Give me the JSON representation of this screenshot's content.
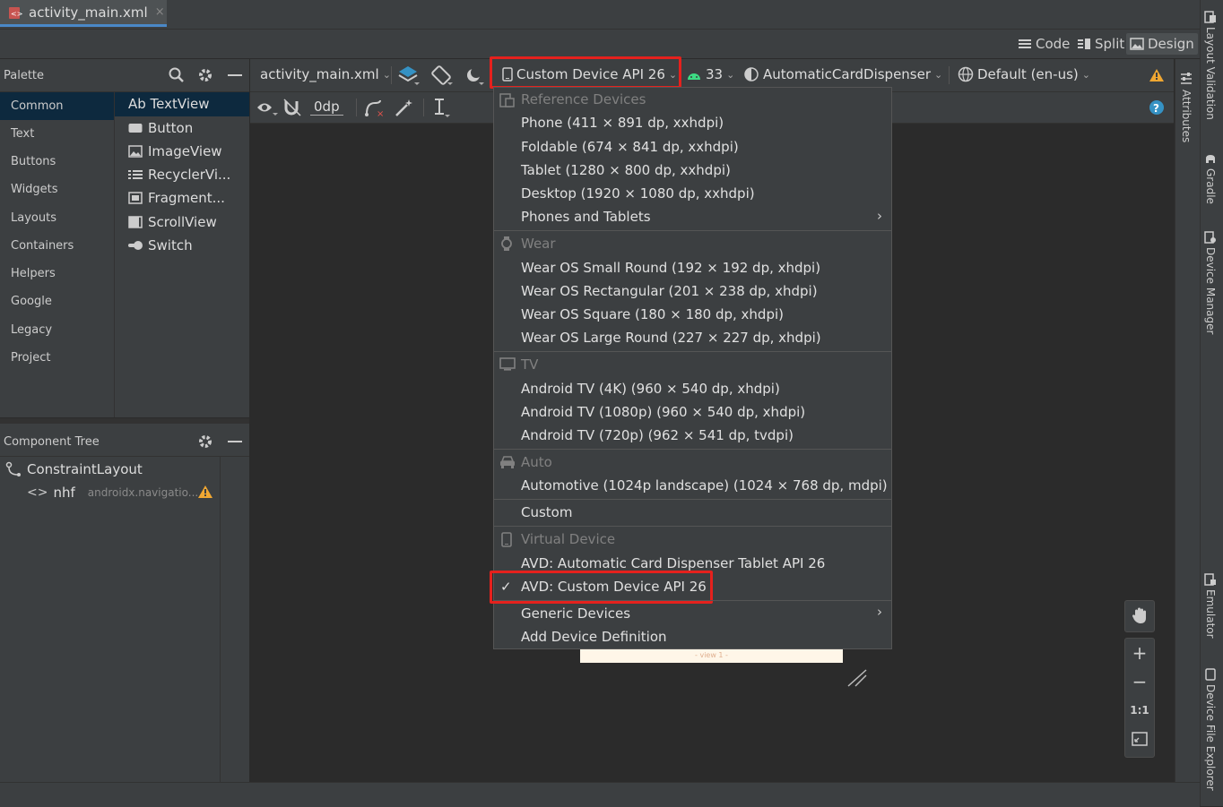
{
  "tab": {
    "filename": "activity_main.xml",
    "close": "×"
  },
  "modes": {
    "code": "Code",
    "split": "Split",
    "design": "Design"
  },
  "palette": {
    "title": "Palette",
    "categories": [
      "Common",
      "Text",
      "Buttons",
      "Widgets",
      "Layouts",
      "Containers",
      "Helpers",
      "Google",
      "Legacy",
      "Project"
    ],
    "widgets": [
      {
        "icon": "text-view-icon",
        "label": "Ab TextView"
      },
      {
        "icon": "button-icon",
        "label": "Button"
      },
      {
        "icon": "image-view-icon",
        "label": "ImageView"
      },
      {
        "icon": "recycler-view-icon",
        "label": "RecyclerVi..."
      },
      {
        "icon": "fragment-icon",
        "label": "Fragment..."
      },
      {
        "icon": "scroll-view-icon",
        "label": "ScrollView"
      },
      {
        "icon": "switch-icon",
        "label": "Switch"
      }
    ]
  },
  "component_tree": {
    "title": "Component Tree",
    "root": "ConstraintLayout",
    "child_id": "nhf",
    "child_class": "androidx.navigatio..."
  },
  "toolbar": {
    "file": "activity_main.xml",
    "device": "Custom Device API 26",
    "api": "33",
    "theme": "AutomaticCardDispenser",
    "locale": "Default (en-us)",
    "margin": "0dp"
  },
  "menu": {
    "reference_header": "Reference Devices",
    "reference": [
      "Phone (411 × 891 dp, xxhdpi)",
      "Foldable (674 × 841 dp, xxhdpi)",
      "Tablet (1280 × 800 dp, xxhdpi)",
      "Desktop (1920 × 1080 dp, xxhdpi)",
      "Phones and Tablets"
    ],
    "wear_header": "Wear",
    "wear": [
      "Wear OS Small Round (192 × 192 dp, xhdpi)",
      "Wear OS Rectangular (201 × 238 dp, xhdpi)",
      "Wear OS Square (180 × 180 dp, xhdpi)",
      "Wear OS Large Round (227 × 227 dp, xhdpi)"
    ],
    "tv_header": "TV",
    "tv": [
      "Android TV (4K) (960 × 540 dp, xhdpi)",
      "Android TV (1080p) (960 × 540 dp, xhdpi)",
      "Android TV (720p) (962 × 541 dp, tvdpi)"
    ],
    "auto_header": "Auto",
    "auto": [
      "Automotive (1024p landscape) (1024 × 768 dp, mdpi)"
    ],
    "custom": "Custom",
    "virtual_header": "Virtual Device",
    "virtual": [
      "AVD: Automatic Card Dispenser Tablet API 26",
      "AVD: Custom Device API 26"
    ],
    "checkmark": "✓",
    "generic": "Generic Devices",
    "add": "Add Device Definition"
  },
  "side_tools": {
    "attributes": "Attributes",
    "layout_validation": "Layout Validation",
    "gradle": "Gradle",
    "device_manager": "Device Manager",
    "emulator": "Emulator",
    "device_file_explorer": "Device File Explorer"
  },
  "zoom": {
    "plus": "+",
    "minus": "−",
    "actual": "1:1"
  },
  "preview_label": "- view 1 -",
  "colors": {
    "accent": "#4a88c7",
    "highlight": "#e5211d",
    "warning": "#f0a732"
  }
}
